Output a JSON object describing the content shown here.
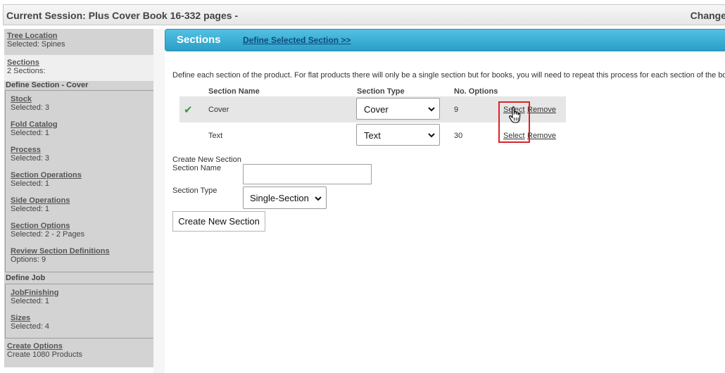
{
  "session": {
    "title": "Current Session: Plus Cover Book 16-332 pages -",
    "change_label": "Change"
  },
  "sidebar": {
    "tree_location": {
      "label": "Tree Location",
      "sub": "Selected: Spines"
    },
    "sections": {
      "label": "Sections",
      "sub": "2 Sections:"
    },
    "define_section_heading": "Define Section - Cover",
    "section_items": [
      {
        "label": "Stock",
        "sub": "Selected: 3"
      },
      {
        "label": "Fold Catalog",
        "sub": "Selected: 1"
      },
      {
        "label": "Process",
        "sub": "Selected: 3"
      },
      {
        "label": "Section Operations",
        "sub": "Selected: 1"
      },
      {
        "label": "Side Operations",
        "sub": "Selected: 1"
      },
      {
        "label": "Section Options",
        "sub": "Selected: 2 - 2 Pages"
      },
      {
        "label": "Review Section Definitions",
        "sub": "Options: 9"
      }
    ],
    "define_job_heading": "Define Job",
    "job_items": [
      {
        "label": "JobFinishing",
        "sub": "Selected: 1"
      },
      {
        "label": "Sizes",
        "sub": "Selected: 4"
      }
    ],
    "create_options": {
      "label": "Create Options",
      "sub": "Create 1080 Products"
    }
  },
  "header": {
    "title": "Sections",
    "define_link": "Define Selected Section >>"
  },
  "intro_text": "Define each section of the product. For flat products there will only be a single section but for books, you will need to repeat this process for each section of the book.",
  "table": {
    "columns": [
      "Section Name",
      "Section Type",
      "No. Options"
    ],
    "rows": [
      {
        "name": "Cover",
        "type": "Cover",
        "options": "9",
        "select": "Select",
        "remove": "Remove",
        "checked": true
      },
      {
        "name": "Text",
        "type": "Text",
        "options": "30",
        "select": "Select",
        "remove": "Remove",
        "checked": false
      }
    ]
  },
  "create_form": {
    "heading": "Create New Section",
    "name_label": "Section Name",
    "name_value": "",
    "type_label": "Section Type",
    "type_value": "Single-Section",
    "button_label": "Create New Section"
  },
  "icons": {
    "check": "check-icon",
    "dropdown": "chevron-down-icon",
    "cursor": "hand-pointer-icon"
  },
  "colors": {
    "header_bar": "#3aaed6",
    "sidebar": "#d3d3d3",
    "highlight": "#d9232a",
    "check": "#3a9a3a"
  }
}
